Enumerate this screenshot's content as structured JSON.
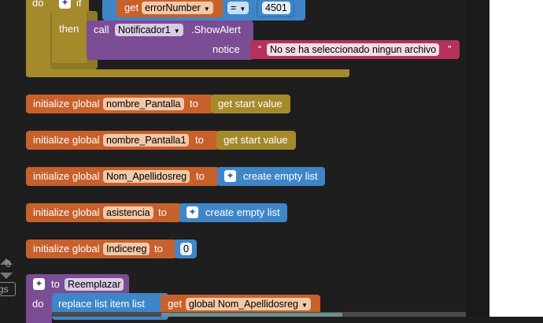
{
  "if_block": {
    "do_label": "do",
    "if_label": "if",
    "then_label": "then",
    "get_label": "get",
    "var_name": "errorNumber",
    "operator": "=",
    "compare_value": "4501",
    "call_label": "call",
    "component": "Notificador1",
    "method": ".ShowAlert",
    "notice_label": "notice",
    "notice_text": "No se ha seleccionado ningun archivo",
    "quote_open": "“",
    "quote_close": "”"
  },
  "globals": [
    {
      "init_label": "initialize global",
      "name": "nombre_Pantalla",
      "to_label": "to",
      "value": "get start value"
    },
    {
      "init_label": "initialize global",
      "name": "nombre_Pantalla1",
      "to_label": "to",
      "value": "get start value"
    },
    {
      "init_label": "initialize global",
      "name": "Nom_Apellidosreg",
      "to_label": "to",
      "value": "create empty list"
    },
    {
      "init_label": "initialize global",
      "name": "asistencia",
      "to_label": "to",
      "value": "create empty list"
    },
    {
      "init_label": "initialize global",
      "name": "Indicereg",
      "to_label": "to",
      "value": "0"
    }
  ],
  "procedure": {
    "to_label": "to",
    "name": "Reemplazar",
    "do_label": "do",
    "replace_label": "replace list item  list",
    "get_label": "get",
    "global_var": "global Nom_Apellidosreg"
  },
  "workspace": {
    "counter": "0",
    "tab_label": "gs"
  },
  "icons": {
    "gear": "gear-icon",
    "dropdown": "dropdown-arrow-icon"
  },
  "colors": {
    "background": "#1e1e1e",
    "control": "#a58a2c",
    "variables": "#c8602b",
    "lists": "#3f86c9",
    "component_method": "#7a4d94",
    "text": "#b5335b",
    "procedures": "#7a4d94"
  }
}
